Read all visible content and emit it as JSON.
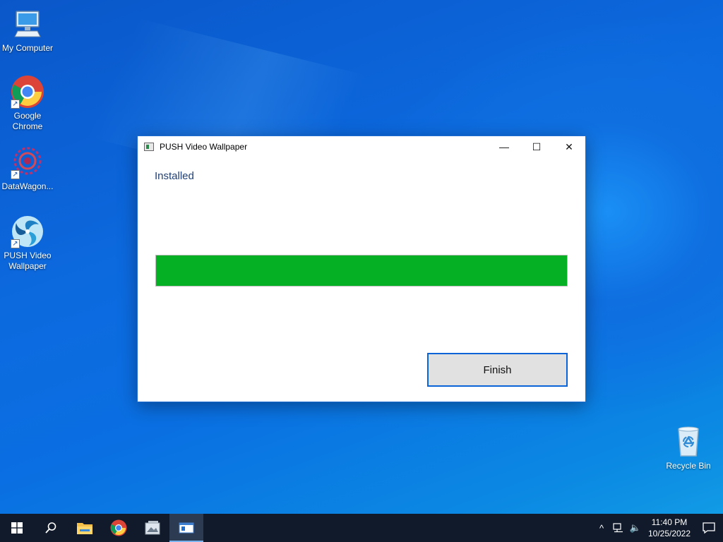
{
  "desktop": {
    "icons": [
      {
        "label": "My Computer"
      },
      {
        "label": "Google Chrome"
      },
      {
        "label": "DataWagon..."
      },
      {
        "label": "PUSH Video Wallpaper"
      },
      {
        "label": "Recycle Bin"
      }
    ]
  },
  "window": {
    "title": "PUSH Video Wallpaper",
    "status": "Installed",
    "progress_percent": 100,
    "finish_label": "Finish",
    "minimize_glyph": "—",
    "maximize_glyph": "☐",
    "close_glyph": "✕"
  },
  "taskbar": {
    "time": "11:40 PM",
    "date": "10/25/2022",
    "tray_up_glyph": "^",
    "volume_glyph": "🔈"
  },
  "colors": {
    "progress": "#06b025",
    "accent": "#0a64d8"
  }
}
